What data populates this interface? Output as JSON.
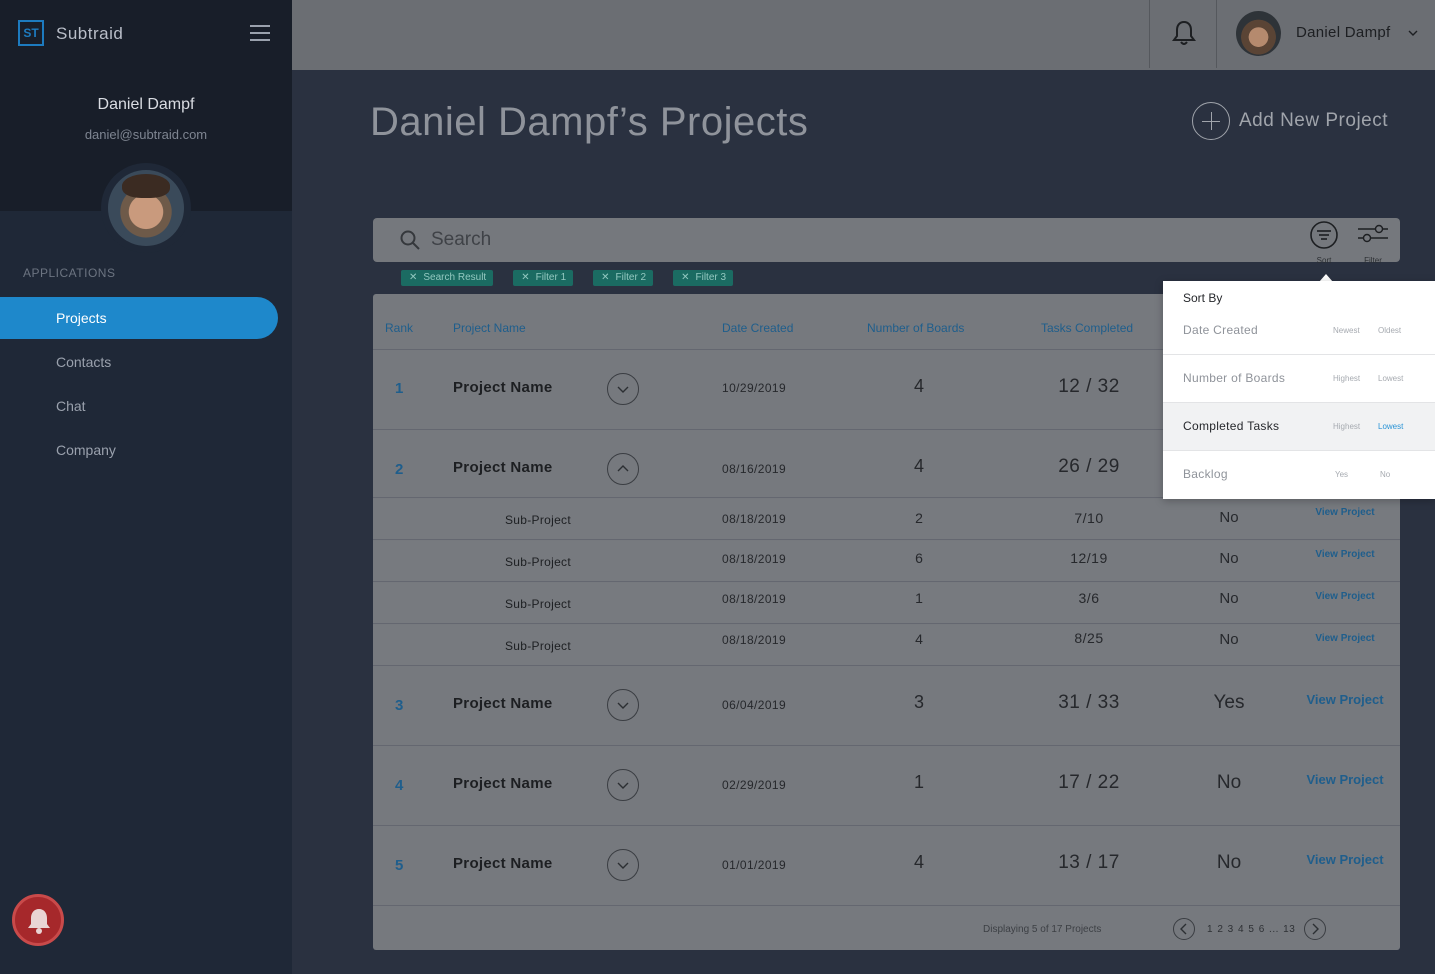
{
  "app": {
    "logo_text": "ST",
    "name": "Subtraid"
  },
  "sidebar": {
    "user_name": "Daniel Dampf",
    "user_email": "daniel@subtraid.com",
    "section_label": "APPLICATIONS",
    "items": [
      {
        "label": "Projects",
        "active": true
      },
      {
        "label": "Contacts",
        "active": false
      },
      {
        "label": "Chat",
        "active": false
      },
      {
        "label": "Company",
        "active": false
      }
    ]
  },
  "header": {
    "user_name": "Daniel Dampf"
  },
  "page": {
    "title": "Daniel Dampf’s Projects",
    "add_label": "Add New Project"
  },
  "search": {
    "placeholder": "Search",
    "value": "",
    "sort_label": "Sort",
    "filter_label": "Filter"
  },
  "chips": [
    "Search Result",
    "Filter 1",
    "Filter 2",
    "Filter 3"
  ],
  "table": {
    "headers": {
      "rank": "Rank",
      "name": "Project Name",
      "date": "Date Created",
      "boards": "Number of Boards",
      "tasks": "Tasks Completed"
    },
    "rows": [
      {
        "rank": "1",
        "name": "Project Name",
        "date": "10/29/2019",
        "boards": "4",
        "tasks": "12 / 32",
        "backlog": "",
        "view": ""
      },
      {
        "rank": "2",
        "name": "Project Name",
        "date": "08/16/2019",
        "boards": "4",
        "tasks": "26 / 29",
        "backlog": "",
        "view": ""
      },
      {
        "rank": "3",
        "name": "Project Name",
        "date": "06/04/2019",
        "boards": "3",
        "tasks": "31 / 33",
        "backlog": "Yes",
        "view": "View Project"
      },
      {
        "rank": "4",
        "name": "Project Name",
        "date": "02/29/2019",
        "boards": "1",
        "tasks": "17 / 22",
        "backlog": "No",
        "view": "View Project"
      },
      {
        "rank": "5",
        "name": "Project Name",
        "date": "01/01/2019",
        "boards": "4",
        "tasks": "13 / 17",
        "backlog": "No",
        "view": "View Project"
      }
    ],
    "sub_rows": [
      {
        "name": "Sub-Project",
        "date": "08/18/2019",
        "boards": "2",
        "tasks": "7/10",
        "backlog": "No",
        "view": "View Project"
      },
      {
        "name": "Sub-Project",
        "date": "08/18/2019",
        "boards": "6",
        "tasks": "12/19",
        "backlog": "No",
        "view": "View Project"
      },
      {
        "name": "Sub-Project",
        "date": "08/18/2019",
        "boards": "1",
        "tasks": "3/6",
        "backlog": "No",
        "view": "View Project"
      },
      {
        "name": "Sub-Project",
        "date": "08/18/2019",
        "boards": "4",
        "tasks": "8/25",
        "backlog": "No",
        "view": "View Project"
      }
    ],
    "footer_text": "Displaying 5 of 17 Projects",
    "pagination": "1 2 3 4 5 6 ... 13"
  },
  "sort_menu": {
    "title": "Sort By",
    "rows": [
      {
        "label": "Date Created",
        "opt1": "Newest",
        "opt2": "Oldest"
      },
      {
        "label": "Number of Boards",
        "opt1": "Highest",
        "opt2": "Lowest"
      },
      {
        "label": "Completed Tasks",
        "opt1": "Highest",
        "opt2": "Lowest"
      },
      {
        "label": "Backlog",
        "opt1": "Yes",
        "opt2": "No"
      }
    ]
  },
  "colors": {
    "accent": "#1e88cb",
    "sidebar": "#1f2837",
    "chip": "#1b6b62",
    "notification": "#a6282b"
  },
  "icons": [
    "menu-icon",
    "bell-icon",
    "chevron-down-icon",
    "search-icon",
    "sort-icon",
    "filter-icon",
    "plus-icon",
    "chevron-up-icon",
    "chevron-left-icon",
    "chevron-right-icon",
    "close-icon"
  ]
}
